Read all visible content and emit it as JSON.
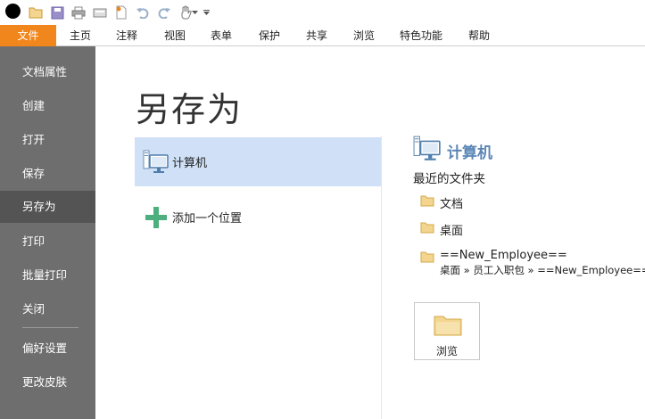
{
  "quick_access": {
    "icons": [
      "app-logo-icon",
      "open-folder-icon",
      "save-icon",
      "print-icon",
      "scan-icon",
      "new-icon",
      "undo-icon",
      "redo-icon",
      "hand-tool-icon",
      "dropdown-arrow-icon",
      "customize-arrow-icon"
    ]
  },
  "tabs": [
    {
      "label": "文件",
      "active": true
    },
    {
      "label": "主页"
    },
    {
      "label": "注释"
    },
    {
      "label": "视图"
    },
    {
      "label": "表单"
    },
    {
      "label": "保护"
    },
    {
      "label": "共享"
    },
    {
      "label": "浏览"
    },
    {
      "label": "特色功能"
    },
    {
      "label": "帮助"
    }
  ],
  "nav": {
    "items": [
      {
        "label": "文档属性"
      },
      {
        "label": "创建"
      },
      {
        "label": "打开"
      },
      {
        "label": "保存"
      },
      {
        "label": "另存为",
        "active": true
      },
      {
        "label": "打印"
      },
      {
        "label": "批量打印"
      },
      {
        "label": "关闭"
      },
      {
        "label": "偏好设置"
      },
      {
        "label": "更改皮肤"
      }
    ]
  },
  "main": {
    "title": "另存为",
    "places": [
      {
        "label": "计算机",
        "icon": "computer-icon",
        "selected": true
      },
      {
        "label": "添加一个位置",
        "icon": "add-location-icon"
      }
    ],
    "detail": {
      "title": "计算机",
      "recent_label": "最近的文件夹",
      "folders": [
        {
          "name": "文档"
        },
        {
          "name": "桌面"
        },
        {
          "name": "==New_Employee=="
        }
      ],
      "folder_path": "桌面 » 员工入职包 » ==New_Employee==",
      "browse_label": "浏览"
    }
  },
  "colors": {
    "accent_orange": "#f0861c",
    "nav_bg": "#6e6e6e",
    "nav_active": "#545454",
    "selected_bg": "#cfe0f7",
    "detail_title": "#5b86b5",
    "folder": "#e9c06b",
    "plus": "#4caf7d"
  }
}
